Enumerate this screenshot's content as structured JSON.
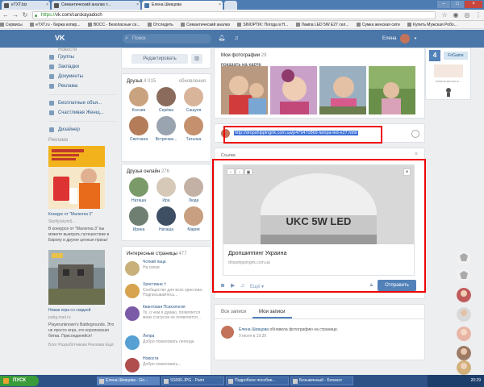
{
  "browser": {
    "tabs": [
      {
        "label": "eTXT.biz",
        "active": false
      },
      {
        "label": "Семантический анализ т...",
        "active": false
      },
      {
        "label": "Елена Шевцова",
        "active": true
      },
      {
        "label": "",
        "active": false
      }
    ],
    "url_scheme": "https://",
    "url_rest": "vk.com/carskayadoch",
    "bookmarks": [
      "Сервисы",
      "eTXT.ru - биржа копир...",
      "ВОСС - Безопасные се...",
      "Отследить",
      "Семантический анализ",
      "SINOPTIK: Погода в Н...",
      "Лампа LED 5W E27 сел...",
      "Сумка женская сити",
      "Купить Мужская Робо..."
    ]
  },
  "vk_header": {
    "logo": "VK",
    "search_placeholder": "Поиск",
    "user_name": "Елена"
  },
  "left_menu": {
    "items": [
      {
        "label": "Новости",
        "muted": true
      },
      {
        "label": "Группы"
      },
      {
        "label": "Закладки"
      },
      {
        "label": "Документы"
      },
      {
        "label": "Реклама"
      }
    ],
    "apps": [
      {
        "label": "Бесплатные объя..."
      },
      {
        "label": "Счастливая Женщ..."
      }
    ],
    "app3": {
      "label": "Дизайнер"
    },
    "ad_label": "Реклама",
    "ad1": {
      "title": "Конкурс от \"Малютка 3\"",
      "site": "Skyfly(skytel)...",
      "text": "В конкурсе от \"Малютка 3\" вы можете выиграть путешествие в Европу и другие ценные призы!"
    },
    "ad2": {
      "title": "Новая игра со скидкой",
      "site": "pubg.mail.ru",
      "text": "Playerunknown's Battlegrounds. Это не просто игра, это королевская битва. Присоединяйся!"
    },
    "footer": "Блог  Разработчикам  Реклама  Ещё"
  },
  "mid": {
    "edit_label": "Редактировать",
    "friends_title": "Друзья",
    "friends_count": "4 015",
    "friends_updates": "обновления",
    "friends": [
      "Ксения",
      "Серёжа",
      "Сашуля",
      "Светлана",
      "Встречаю...",
      "Татьяна"
    ],
    "online_title": "Друзья онлайн",
    "online_count": "276",
    "online": [
      "Наташа",
      "Ира",
      "Люда",
      "Ирина",
      "Наташа",
      "Мария"
    ],
    "pages_title": "Интересные страницы",
    "pages_count": "477",
    "pages": [
      {
        "title": "Чоткий паца",
        "desc": "На связи"
      },
      {
        "title": "Христиане †",
        "desc": "Сообщество для всех христиан. Подписывайтесь..."
      },
      {
        "title": "Квантовая Психология",
        "desc": "То, о чем я думаю, появляется моих статусов не появляется..."
      },
      {
        "title": "Лепра",
        "desc": "Добро пожаловать легенда"
      },
      {
        "title": "Новости",
        "desc": "Добро пожаловать..."
      }
    ]
  },
  "main": {
    "photos_title": "Мои фотографии",
    "photos_count": "29",
    "photos_map": "показать на карте",
    "compose_link": "http://dropshippingnk.com.ua/p479470869-lampa-led-e27.html",
    "snippet_label": "Ссылка",
    "snippet_image_text": "UKC 5W LED",
    "snippet_title": "Дропшиппинг Украина",
    "snippet_url": "dropshippingnk.com.ua",
    "more_label": "Ещё",
    "send_label": "Отправить",
    "wall_tabs": [
      "Все записи",
      "Мои записи"
    ],
    "post_author": "Елена Шевцова",
    "post_action": "обновила фотографию на странице.",
    "post_time": "9 июля в 19:30"
  },
  "widget": {
    "brand": "4",
    "label": "FriGame",
    "note": "Шпили-вилли в..."
  },
  "taskbar": {
    "start": "ПУСК",
    "items": [
      "Елена Шевцова - Go...",
      "SS000.JPG - Paint",
      "Подробное пособие...",
      "Безымянный - Блокнот"
    ],
    "clock": "20:29"
  },
  "colors": {
    "vk_blue": "#4a76a8",
    "link": "#2a5885",
    "highlight": "#e00000",
    "button": "#5181b8"
  }
}
